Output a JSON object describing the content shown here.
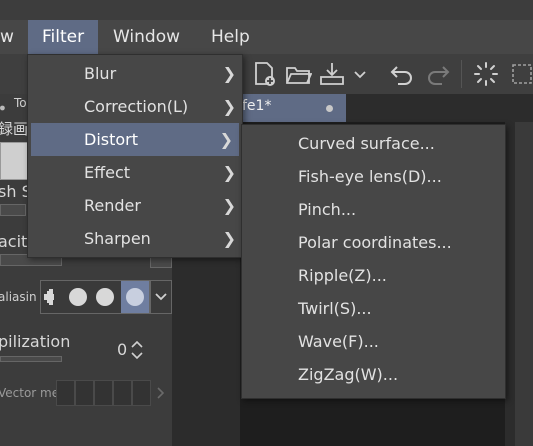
{
  "menubar": {
    "items": [
      {
        "label": "w"
      },
      {
        "label": "Filter"
      },
      {
        "label": "Window"
      },
      {
        "label": "Help"
      }
    ]
  },
  "canvas_tab": {
    "label": "fe1*"
  },
  "left_panel": {
    "tool_label": "To",
    "cjk_text": "録画",
    "brush_size_label": "sh S",
    "opacity_label": "acity",
    "antialias_label": "aliasin",
    "stabilization_label": "pilization",
    "stabilization_value": "0",
    "vector_label": "Vector me"
  },
  "filter_menu": {
    "items": [
      {
        "label": "Blur",
        "submenu": true
      },
      {
        "label": "Correction(L)",
        "submenu": true
      },
      {
        "label": "Distort",
        "submenu": true,
        "highlighted": true
      },
      {
        "label": "Effect",
        "submenu": true
      },
      {
        "label": "Render",
        "submenu": true
      },
      {
        "label": "Sharpen",
        "submenu": true
      }
    ]
  },
  "distort_menu": {
    "items": [
      {
        "label": "Curved surface..."
      },
      {
        "label": "Fish-eye lens(D)..."
      },
      {
        "label": "Pinch..."
      },
      {
        "label": "Polar coordinates..."
      },
      {
        "label": "Ripple(Z)..."
      },
      {
        "label": "Twirl(S)..."
      },
      {
        "label": "Wave(F)..."
      },
      {
        "label": "ZigZag(W)..."
      }
    ]
  },
  "colors": {
    "highlight": "#5f6b85",
    "menu_bg": "#474747",
    "canvas_bg": "#1e1e1e"
  }
}
